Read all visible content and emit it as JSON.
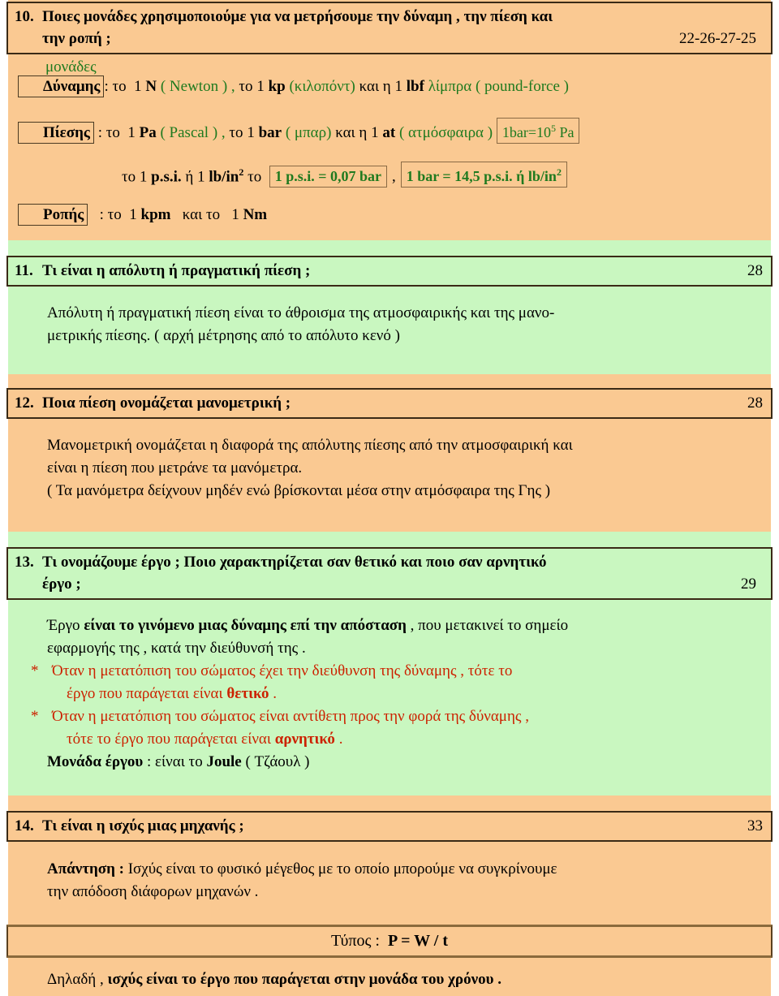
{
  "colors": {
    "orange_band": "#fac992",
    "green_band": "#c9f7c0",
    "green_text": "#1f7a1f",
    "red_text": "#cc2200",
    "box_border": "#3a2a16"
  },
  "questions": [
    {
      "number": "10.",
      "line1": "Ποιες  μονάδες  χρησιμοποιούμε για να μετρήσουμε την  δύναμη , την  πίεση  και",
      "line2": "την  ροπή ;",
      "page_ref": "22-26-27-25"
    },
    {
      "number": "11.",
      "line1": "Τι είναι η απόλυτη  ή πραγματική πίεση ;",
      "page_ref": "28"
    },
    {
      "number": "12.",
      "line1": "Ποια πίεση ονομάζεται μανομετρική ;",
      "page_ref": "28"
    },
    {
      "number": "13.",
      "line1": "Τι ονομάζουμε έργο ; Ποιο χαρακτηρίζεται σαν θετικό και ποιο σαν αρνητικό",
      "line2": "έργο ;",
      "page_ref": "29"
    },
    {
      "number": "14.",
      "line1": "Τι είναι η ισχύς μιας μηχανής ;",
      "page_ref": "33"
    }
  ],
  "answer10": {
    "units_heading": "μονάδες",
    "force": {
      "label": "Δύναμης",
      "colon": ": το",
      "u1_num": "1",
      "u1_sym": "N",
      "u1_name": "( Newton ) ,",
      "mid1": "το",
      "u2_num": "1",
      "u2_sym": "kp",
      "u2_name": "(κιλοπόντ)",
      "mid2": "και η",
      "u3_num": "1",
      "u3_sym": "lbf",
      "u3_name": "λίμπρα",
      "u3_name2": "( pound-force )"
    },
    "pressure": {
      "label": "Πίεσης",
      "colon": ": το",
      "u1_num": "1",
      "u1_sym": "Pa",
      "u1_name": "( Pascal ) ,",
      "mid1": "το",
      "u2_num": "1",
      "u2_sym": "bar",
      "u2_name": "( μπαρ)",
      "mid2": "και η",
      "u3_num": "1",
      "u3_sym": "at",
      "u3_name": "( ατμόσφαιρα )",
      "conv_box": "1bar=10",
      "conv_box_sup": "5",
      "conv_box_tail": " Pa"
    },
    "psi_line": {
      "pre": "το",
      "n1": "1",
      "s1": "p.s.i.",
      "or": "ή",
      "n2": "1",
      "s2": "lb/in",
      "s2sup": "2",
      "mid": "το",
      "box1": "1 p.s.i. = 0,07 bar",
      "comma": ",",
      "box2a": "1 bar = 14,5 p.s.i.  ή  lb/in",
      "box2sup": "2"
    },
    "torque": {
      "label": "Ροπής",
      "colon": ": το",
      "u1_num": "1",
      "u1_sym": "kpm",
      "mid": "και το",
      "u2_num": "1",
      "u2_sym": "Nm"
    }
  },
  "answer11": {
    "line1": "Απόλυτη ή πραγματική πίεση είναι το άθροισμα της ατμοσφαιρικής και της μανο-",
    "line2": "μετρικής πίεσης.   ( αρχή μέτρησης από το απόλυτο κενό )"
  },
  "answer12": {
    "line1": "Μανομετρική ονομάζεται η διαφορά της απόλυτης πίεσης από την ατμοσφαιρική και",
    "line2": "είναι η πίεση που μετράνε τα μανόμετρα.",
    "line3": "( Τα μανόμετρα δείχνουν μηδέν ενώ βρίσκονται μέσα στην ατμόσφαιρα της Γης )"
  },
  "answer13": {
    "l1_a": "Έργο ",
    "l1_b": "είναι το γινόμενο μιας δύναμης επί την απόσταση",
    "l1_c": " , που   μετακινεί το σημείο",
    "l2": "εφαρμογής της , κατά την διεύθυνσή της .",
    "b1_star": "*",
    "b1_l1": "Όταν η μετατόπιση του σώματος έχει την διεύθυνση της δύναμης , τότε το",
    "b1_l2_a": "έργο που παράγεται είναι ",
    "b1_l2_b": "θετικό",
    "b1_l2_c": " .",
    "b2_star": "*",
    "b2_l1": "Όταν η μετατόπιση του σώματος είναι αντίθετη προς την φορά της δύναμης ,",
    "b2_l2_a": "τότε το έργο που παράγεται είναι ",
    "b2_l2_b": "αρνητικό",
    "b2_l2_c": " .",
    "unit_a": "Μονάδα έργου",
    "unit_b": " :  είναι το  ",
    "unit_c": "Joule",
    "unit_d": "  ( Τζάουλ )"
  },
  "answer14": {
    "l1_a": "Απάντηση :",
    "l1_b": " Ισχύς είναι το φυσικό μέγεθος με το οποίο μπορούμε να συγκρίνουμε",
    "l2": "την απόδοση διάφορων μηχανών .",
    "formula_label": "Τύπος :",
    "formula_value": "P = W / t",
    "closing_a": "Δηλαδή , ",
    "closing_b": "ισχύς είναι το έργο που παράγεται στην μονάδα του χρόνου ."
  }
}
